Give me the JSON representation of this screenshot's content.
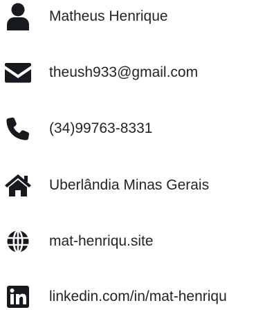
{
  "contact": {
    "items": [
      {
        "icon": "user-icon",
        "text": "Matheus Henrique"
      },
      {
        "icon": "envelope-icon",
        "text": "theush933@gmail.com"
      },
      {
        "icon": "phone-icon",
        "text": "(34)99763-8331"
      },
      {
        "icon": "home-icon",
        "text": "Uberlândia Minas Gerais"
      },
      {
        "icon": "globe-icon",
        "text": "mat-henriqu.site"
      },
      {
        "icon": "linkedin-icon",
        "text": "linkedin.com/in/mat-henriqu"
      }
    ]
  }
}
